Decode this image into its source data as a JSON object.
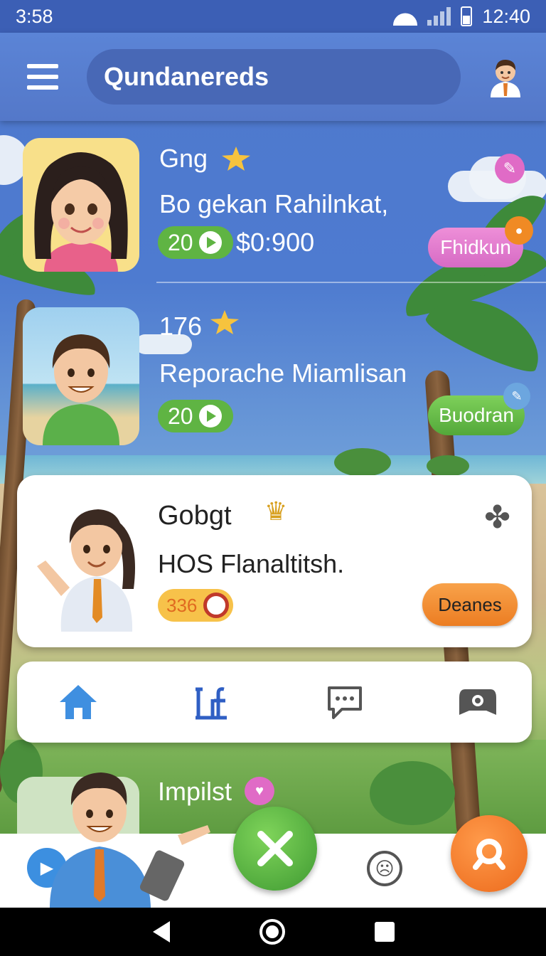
{
  "status_bar": {
    "time_left": "3:58",
    "time_right": "12:40"
  },
  "app_bar": {
    "search_text": "Qundanereds"
  },
  "feed": [
    {
      "title": "Gng",
      "subtitle": "Bo gekan Rahilnkat,",
      "count": "20",
      "price": "$0:900",
      "action": "Fhidkun"
    },
    {
      "title": "176",
      "subtitle": "Reporache Miamlisan",
      "count": "20",
      "action": "Buodran"
    }
  ],
  "card": {
    "title": "Gobgt",
    "subtitle": "HOS Flanaltitsh.",
    "count": "336",
    "button": "Deanes"
  },
  "peek": {
    "title": "Impilst"
  },
  "colors": {
    "primary": "#5478c9",
    "green": "#5fb443",
    "orange": "#ec7d22",
    "pink": "#e06bc6"
  }
}
